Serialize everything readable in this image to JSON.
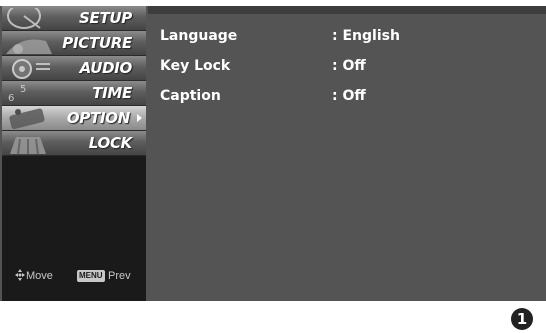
{
  "menu": {
    "items": [
      {
        "label": "SETUP",
        "icon": "satellite-dish-icon"
      },
      {
        "label": "PICTURE",
        "icon": "picture-icon"
      },
      {
        "label": "AUDIO",
        "icon": "speaker-icon"
      },
      {
        "label": "TIME",
        "icon": "clock-icon"
      },
      {
        "label": "OPTION",
        "icon": "option-icon",
        "active": true
      },
      {
        "label": "LOCK",
        "icon": "lock-icon"
      }
    ]
  },
  "footer_hint": {
    "move_icon": "directional-pad-icon",
    "move_label": "Move",
    "menu_key": "MENU",
    "prev_label": "Prev"
  },
  "settings": [
    {
      "name": "Language",
      "value": ": English"
    },
    {
      "name": "Key Lock",
      "value": ": Off"
    },
    {
      "name": "Caption",
      "value": ": Off"
    }
  ],
  "step_number": "1"
}
